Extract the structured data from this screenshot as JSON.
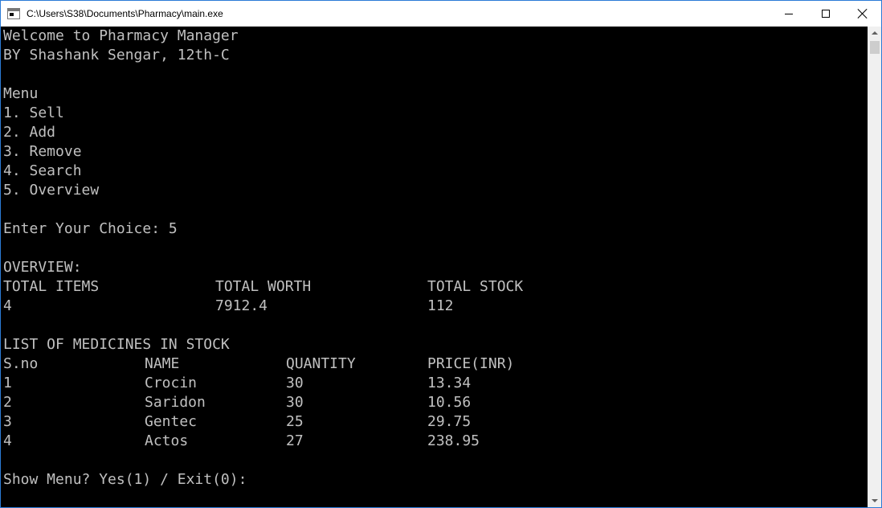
{
  "window": {
    "title": "C:\\Users\\S38\\Documents\\Pharmacy\\main.exe",
    "icon": "console-app-icon"
  },
  "console": {
    "welcome": "Welcome to Pharmacy Manager",
    "author": "BY Shashank Sengar, 12th-C",
    "menu_title": "Menu",
    "menu_items": [
      "1. Sell",
      "2. Add",
      "3. Remove",
      "4. Search",
      "5. Overview"
    ],
    "prompt": "Enter Your Choice: 5",
    "overview_title": "OVERVIEW:",
    "overview_headers": [
      "TOTAL ITEMS",
      "TOTAL WORTH",
      "TOTAL STOCK"
    ],
    "overview_values": [
      "4",
      "7912.4",
      "112"
    ],
    "list_title": "LIST OF MEDICINES IN STOCK",
    "table_headers": [
      "S.no",
      "NAME",
      "QUANTITY",
      "PRICE(INR)"
    ],
    "table_rows": [
      [
        "1",
        "Crocin",
        "30",
        "13.34"
      ],
      [
        "2",
        "Saridon",
        "30",
        "10.56"
      ],
      [
        "3",
        "Gentec",
        "25",
        "29.75"
      ],
      [
        "4",
        "Actos",
        "27",
        "238.95"
      ]
    ],
    "final_prompt": "Show Menu? Yes(1) / Exit(0):"
  },
  "colors": {
    "console_bg": "#000000",
    "console_text": "#c0c0c0",
    "titlebar_bg": "#ffffff"
  }
}
